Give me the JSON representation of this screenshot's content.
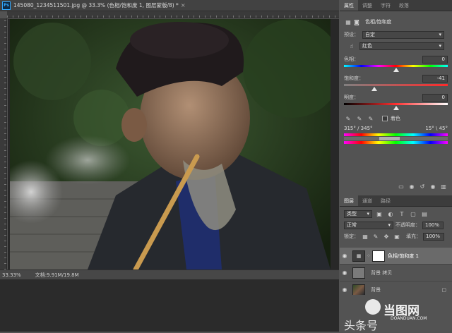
{
  "document": {
    "title": "145080_1234511501.jpg @ 33.3% (色相/饱和度 1, 图层蒙版/8) *",
    "logo": "Ps",
    "close_glyph": "×",
    "zoom": "33.33%",
    "doc_info": "文档:9.91M/19.8M"
  },
  "properties_panel": {
    "tabs": [
      "属性",
      "调整",
      "字符",
      "段落"
    ],
    "header_label": "色相/饱和度",
    "preset_label": "预设：",
    "preset_value": "自定",
    "channel_value": "红色",
    "hue": {
      "label": "色相：",
      "value": "0"
    },
    "saturation": {
      "label": "饱和度：",
      "value": "-41"
    },
    "lightness": {
      "label": "明度：",
      "value": "0"
    },
    "colorize_label": "着色",
    "range_left": "315° / 345°",
    "range_right": "15° \\ 45°"
  },
  "layers_panel": {
    "tabs": [
      "图层",
      "通道",
      "路径"
    ],
    "filter_kind": "类型",
    "blend_mode": "正常",
    "opacity_label": "不透明度：",
    "opacity_value": "100%",
    "lock_label": "锁定：",
    "fill_label": "填充：",
    "fill_value": "100%",
    "layers": [
      {
        "name": "色相/饱和度 1",
        "type": "adjustment"
      },
      {
        "name": "背景 拷贝",
        "type": "copy"
      },
      {
        "name": "背景",
        "type": "background"
      }
    ]
  },
  "watermark": {
    "text_main": "头条号",
    "logo_text": "当图网",
    "logo_sub": "DOANDUAN.COM"
  },
  "colors": {
    "accent": "#31a8ff",
    "panel": "#535353",
    "dark": "#2b2b2b"
  }
}
